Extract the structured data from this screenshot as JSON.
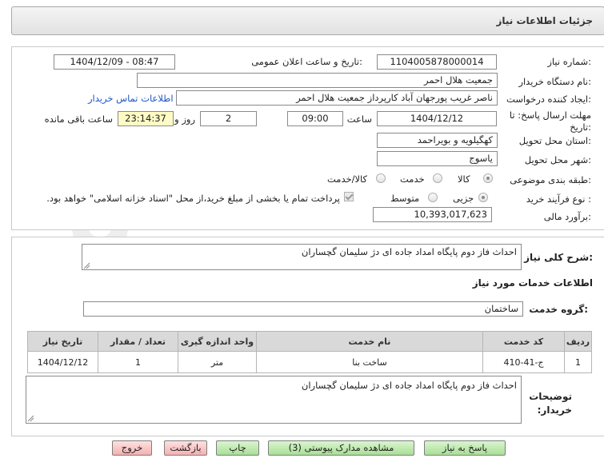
{
  "header": {
    "title": "جزئیات اطلاعات نیاز"
  },
  "fields": {
    "need_number_label": "شماره نیاز:",
    "need_number": "1104005878000014",
    "announce_label": "تاریخ و ساعت اعلان عمومی:",
    "announce_value": "1404/12/09 - 08:47",
    "buyer_org_label": "نام دستگاه خریدار:",
    "buyer_org": "جمعیت هلال احمر",
    "creator_label": "ایجاد کننده درخواست:",
    "creator": "ناصر غریب پورجهان آباد کارپرداز جمعیت هلال احمر",
    "contact_link": "اطلاعات تماس خریدار",
    "deadline_label": "مهلت ارسال پاسخ: تا تاریخ:",
    "deadline_date": "1404/12/12",
    "time_label": "ساعت",
    "deadline_time": "09:00",
    "days": "2",
    "days_label": "روز و",
    "remaining": "23:14:37",
    "remaining_label": "ساعت باقی مانده",
    "province_label": "استان محل تحویل:",
    "province": "کهگیلویه و بویراحمد",
    "city_label": "شهر محل تحویل:",
    "city": "یاسوج",
    "category_label": "طبقه بندی موضوعی:",
    "category_options": [
      "کالا",
      "خدمت",
      "کالا/خدمت"
    ],
    "process_label": "نوع فرآیند خرید :",
    "process_options": [
      "جزیی",
      "متوسط"
    ],
    "payment_note": "پرداخت تمام یا بخشی از مبلغ خرید،از محل \"اسناد خزانه اسلامی\" خواهد بود.",
    "estimate_label": "برآورد مالی:",
    "estimate": "10,393,017,623"
  },
  "description": {
    "label": "شرح کلی نیاز:",
    "text": "احداث فاز دوم پایگاه امداد جاده ای دژ سلیمان گچساران"
  },
  "services": {
    "section_title": "اطلاعات خدمات مورد نیاز",
    "group_label": "گروه خدمت:",
    "group_value": "ساختمان",
    "columns": [
      "ردیف",
      "کد خدمت",
      "نام خدمت",
      "واحد اندازه گیری",
      "تعداد / مقدار",
      "تاریخ نیاز"
    ],
    "rows": [
      [
        "1",
        "ج-41-410",
        "ساخت بنا",
        "متر",
        "1",
        "1404/12/12"
      ]
    ]
  },
  "buyer_notes": {
    "label": "توضیحات خریدار:",
    "text": "احداث فاز دوم پایگاه امداد جاده ای دژ سلیمان گچساران"
  },
  "buttons": {
    "reply": "پاسخ به نیاز",
    "attachments": "مشاهده مدارک پیوستی (3)",
    "print": "چاپ",
    "back": "بازگشت",
    "exit": "خروج"
  },
  "colors": {
    "button_green": "#b8e6a8",
    "button_red": "#f5b8b8",
    "highlight_yellow": "#fffbc6",
    "link_blue": "#1a56c9"
  }
}
